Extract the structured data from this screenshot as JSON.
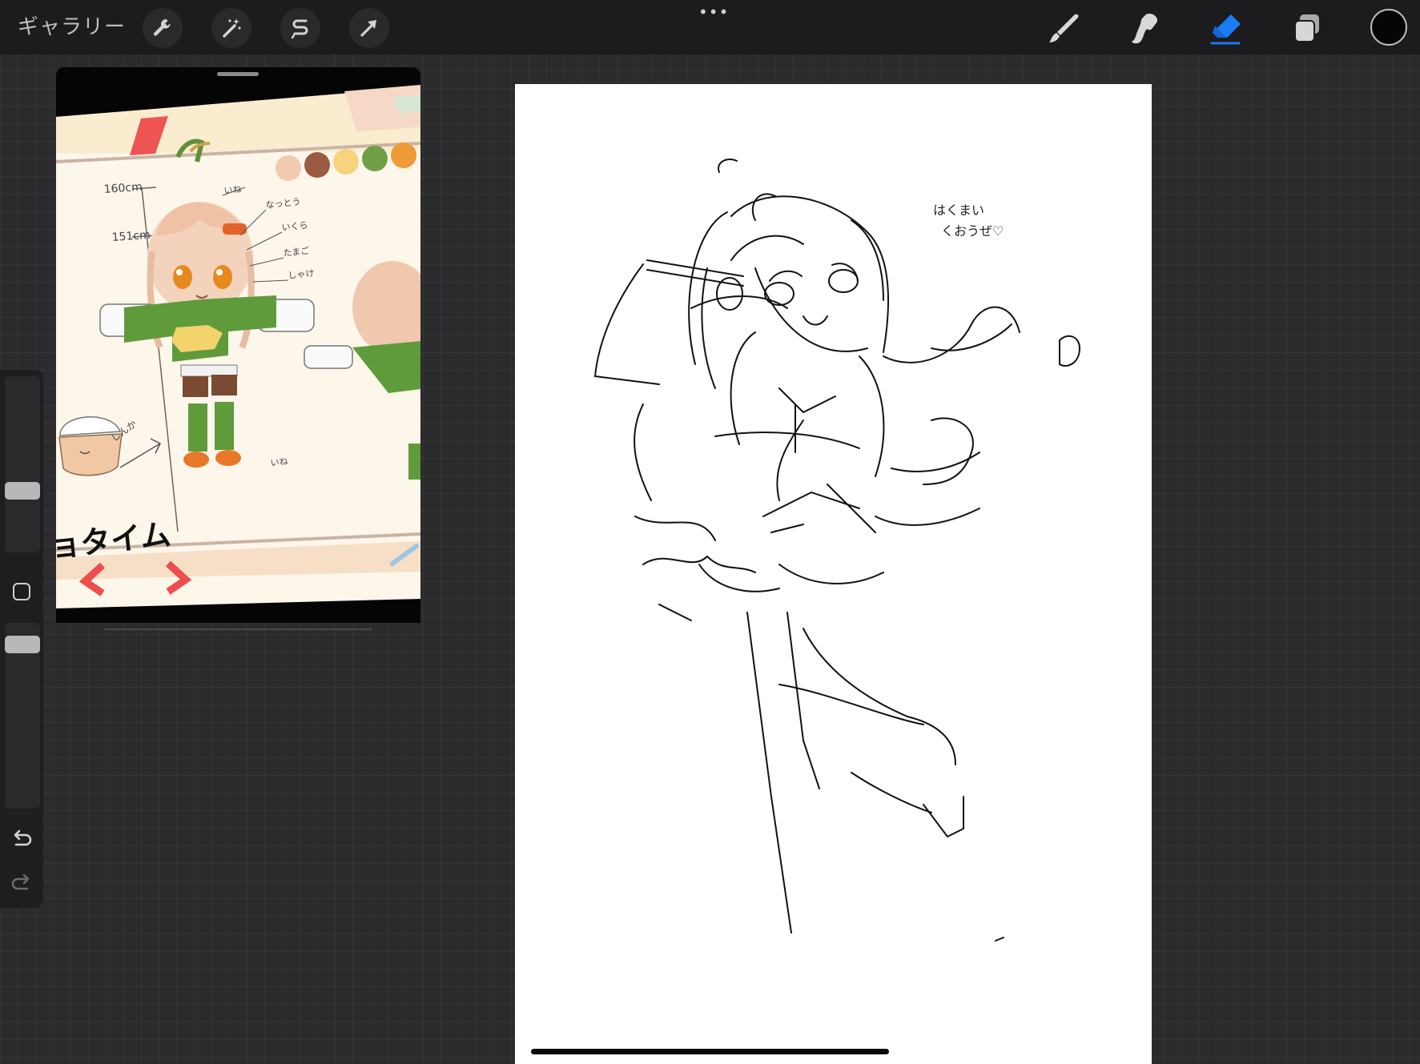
{
  "topbar": {
    "gallery_label": "ギャラリー",
    "more_label": "•••",
    "left_tools": [
      "wrench-icon",
      "magic-wand-icon",
      "selection-icon",
      "transform-arrow-icon"
    ],
    "right_tools": [
      "brush-icon",
      "smudge-icon",
      "eraser-icon",
      "layers-icon"
    ],
    "active_tool": "eraser",
    "active_tool_color": "#1a7cf5",
    "current_color": "#050505"
  },
  "reference": {
    "heights": [
      "160cm",
      "151cm"
    ],
    "labels": [
      "いね",
      "なっとう",
      "いくら",
      "たまご",
      "しゃけ",
      "しんか",
      "いね"
    ],
    "logo_text": "ョタイム",
    "palette": [
      "#f2c9b1",
      "#9a5a3f",
      "#f7d37e",
      "#6fa046",
      "#ee9a38"
    ]
  },
  "canvas": {
    "note_line1": "はくまい",
    "note_line2": "くおうぜ♡"
  },
  "sidebar": {
    "icons": [
      "undo-icon",
      "redo-icon"
    ]
  }
}
